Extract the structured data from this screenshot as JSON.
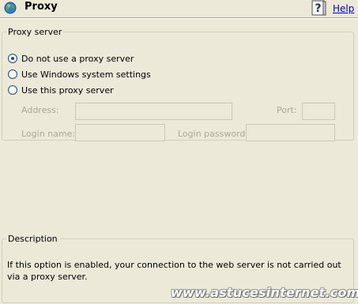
{
  "header": {
    "title": "Proxy",
    "help_label": "Help",
    "icon": "globe-icon",
    "help_icon": "help-book-icon"
  },
  "proxy_server": {
    "legend": "Proxy server",
    "options": [
      {
        "label": "Do not use a proxy server",
        "checked": true
      },
      {
        "label": "Use Windows system settings",
        "checked": false
      },
      {
        "label": "Use this proxy server",
        "checked": false
      }
    ],
    "fields": {
      "address_label": "Address:",
      "address_value": "",
      "port_label": "Port:",
      "port_value": "",
      "login_name_label": "Login name:",
      "login_name_value": "",
      "login_password_label": "Login password:",
      "login_password_value": ""
    }
  },
  "description": {
    "legend": "Description",
    "text": "If this option is enabled, your connection to the web server is not carried out via a proxy server."
  },
  "watermark": "www.astucesinternet.com",
  "colors": {
    "background": "#ece9d8",
    "link": "#0000cc",
    "disabled_text": "#aca899"
  }
}
